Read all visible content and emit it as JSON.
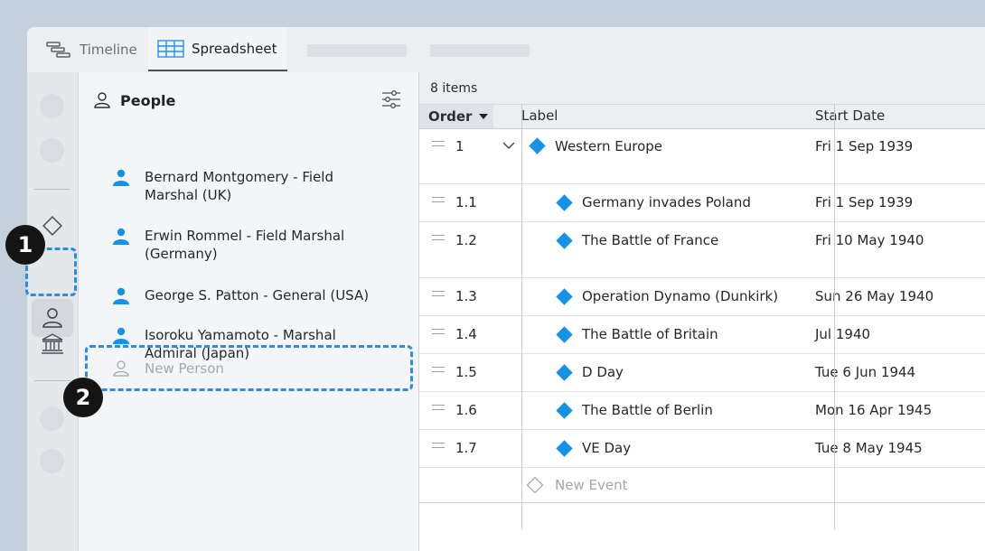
{
  "tabs": [
    {
      "label": "Timeline",
      "icon": "timeline-icon",
      "active": false
    },
    {
      "label": "Spreadsheet",
      "icon": "spreadsheet-icon",
      "active": true
    }
  ],
  "people_panel": {
    "title": "People",
    "people": [
      {
        "name": "Bernard Montgomery - Field Marshal (UK)"
      },
      {
        "name": "Erwin Rommel - Field Marshal (Germany)"
      },
      {
        "name": "George S. Patton - General (USA)"
      },
      {
        "name": "Isoroku Yamamoto - Marshal Admiral (Japan)"
      }
    ],
    "new_person_placeholder": "New Person"
  },
  "sheet": {
    "item_count": "8 items",
    "columns": {
      "order": "Order",
      "label": "Label",
      "start_date": "Start Date"
    },
    "rows": [
      {
        "order": "1",
        "label": "Western Europe",
        "start": "Fri 1 Sep 1939",
        "group": true
      },
      {
        "order": "1.1",
        "label": "Germany invades Poland",
        "start": "Fri 1 Sep 1939"
      },
      {
        "order": "1.2",
        "label": "The Battle of France",
        "start": "Fri 10 May 1940"
      },
      {
        "order": "1.3",
        "label": "Operation Dynamo (Dunkirk)",
        "start": "Sun 26 May 1940"
      },
      {
        "order": "1.4",
        "label": "The Battle of Britain",
        "start": "Jul 1940"
      },
      {
        "order": "1.5",
        "label": "D Day",
        "start": "Tue 6 Jun 1944"
      },
      {
        "order": "1.6",
        "label": "The Battle of Berlin",
        "start": "Mon 16 Apr 1945"
      },
      {
        "order": "1.7",
        "label": "VE Day",
        "start": "Tue 8 May 1945"
      }
    ],
    "new_event_placeholder": "New Event"
  },
  "callouts": [
    "1",
    "2"
  ],
  "colors": {
    "accent": "#1592e6",
    "highlight": "#2f8be0"
  }
}
